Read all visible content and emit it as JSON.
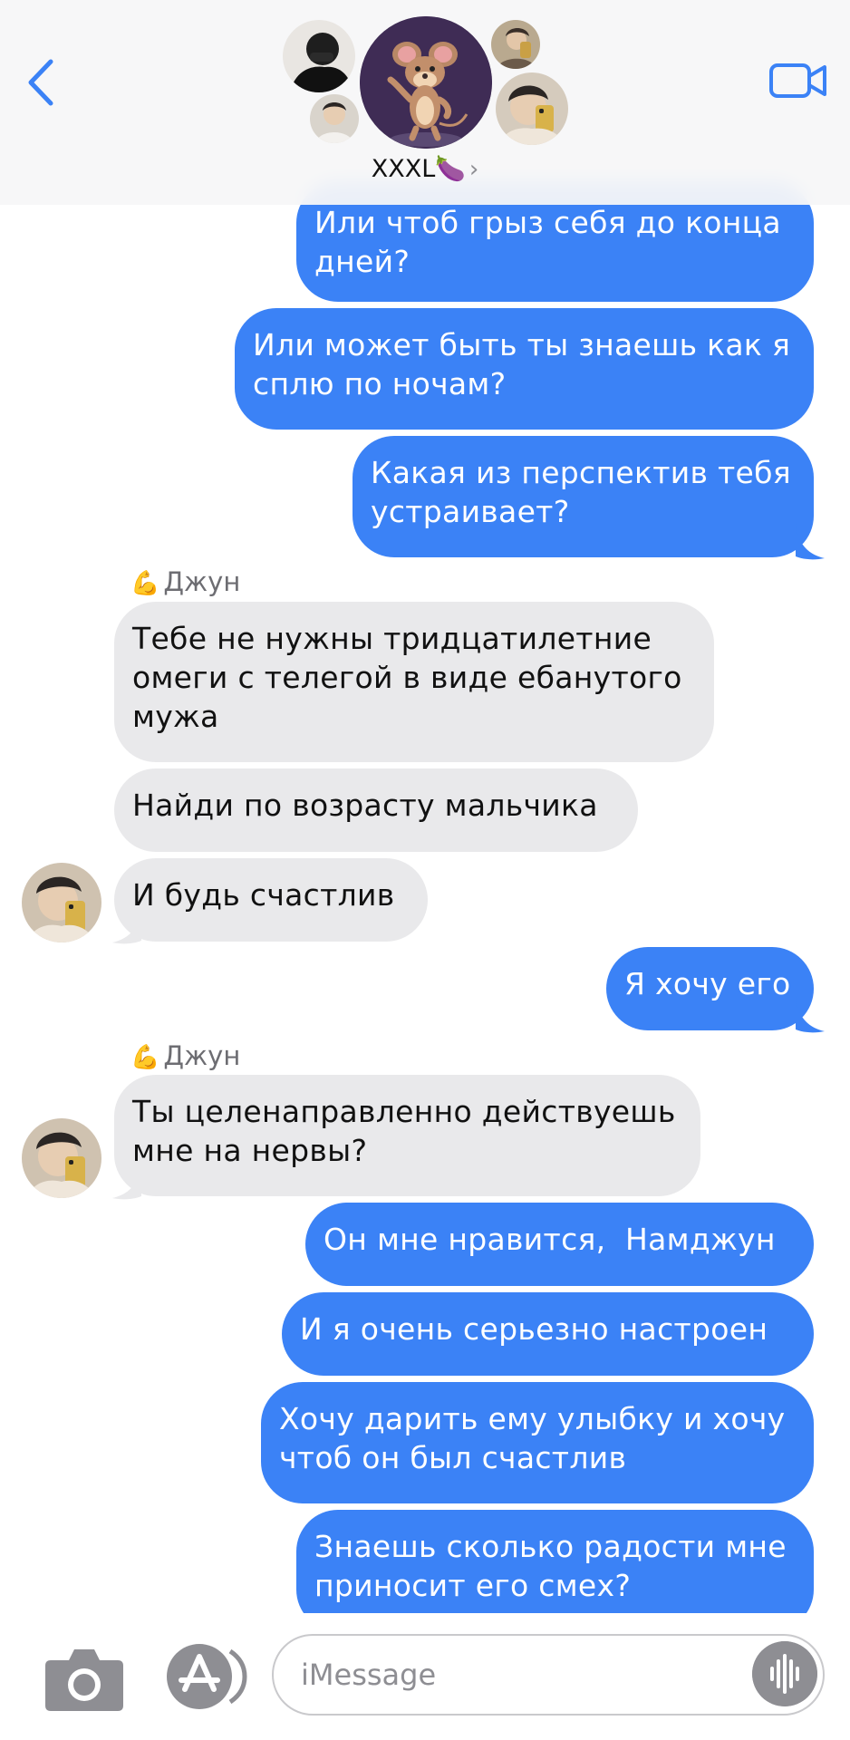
{
  "header": {
    "group_name": "XXXL🍆",
    "chevron": "›",
    "back_icon": "chevron-left-icon",
    "video_icon": "video-camera-icon",
    "accent_color": "#3b82f6"
  },
  "messages": [
    {
      "side": "out",
      "lines": [
        "Или чтоб грыз себя до конца",
        "дней?"
      ]
    },
    {
      "side": "out",
      "lines": [
        "Или может быть ты знаешь как я",
        "сплю по ночам?"
      ]
    },
    {
      "side": "out",
      "lines": [
        "Какая из перспектив тебя",
        "устраивает?"
      ]
    },
    {
      "sender": "💪 Джун"
    },
    {
      "side": "in",
      "lines": [
        "Тебе не нужны тридцатилетние",
        "омеги с телегой в виде ебанутого",
        "мужа"
      ]
    },
    {
      "side": "in",
      "lines": [
        "Найди по возрасту мальчика"
      ]
    },
    {
      "side": "in",
      "lines": [
        "И будь счастлив"
      ]
    },
    {
      "side": "out",
      "lines": [
        "Я хочу его"
      ]
    },
    {
      "sender": "💪 Джун"
    },
    {
      "side": "in",
      "lines": [
        "Ты целенаправленно действуешь",
        "мне на нервы?"
      ]
    },
    {
      "side": "out",
      "lines": [
        "Он мне нравится,  Намджун"
      ]
    },
    {
      "side": "out",
      "lines": [
        "И я очень серьезно настроен"
      ]
    },
    {
      "side": "out",
      "lines": [
        "Хочу дарить ему улыбку и хочу",
        "чтоб он был счастлив"
      ]
    },
    {
      "side": "out",
      "lines": [
        "Знаешь сколько радости мне",
        "приносит его смех?"
      ]
    }
  ],
  "bubbles": {
    "m1": "Или чтоб грыз себя до конца\nдней?",
    "m2": "Или может быть ты знаешь как я\nсплю по ночам?",
    "m3": "Какая из перспектив тебя\nустраивает?",
    "s1": "Джун",
    "m4": "Тебе не нужны тридцатилетние\nомеги с телегой в виде ебанутого\nмужа",
    "m5": "Найди по возрасту мальчика",
    "m6": "И будь счастлив",
    "m7": "Я хочу его",
    "s2": "Джун",
    "m8": "Ты целенаправленно действуешь\nмне на нервы?",
    "m9": "Он мне нравится,  Намджун",
    "m10": "И я очень серьезно настроен",
    "m11": "Хочу дарить ему улыбку и хочу\nчтоб он был счастлив",
    "m12": "Знаешь сколько радости мне\nприносит его смех?"
  },
  "sender_emoji": "💪",
  "input": {
    "placeholder": "iMessage",
    "camera_icon": "camera-icon",
    "apps_icon": "app-store-icon",
    "voice_icon": "waveform-icon"
  },
  "colors": {
    "outgoing": "#3b82f6",
    "incoming": "#e9e9eb",
    "secondary_text": "#6d6d72"
  }
}
